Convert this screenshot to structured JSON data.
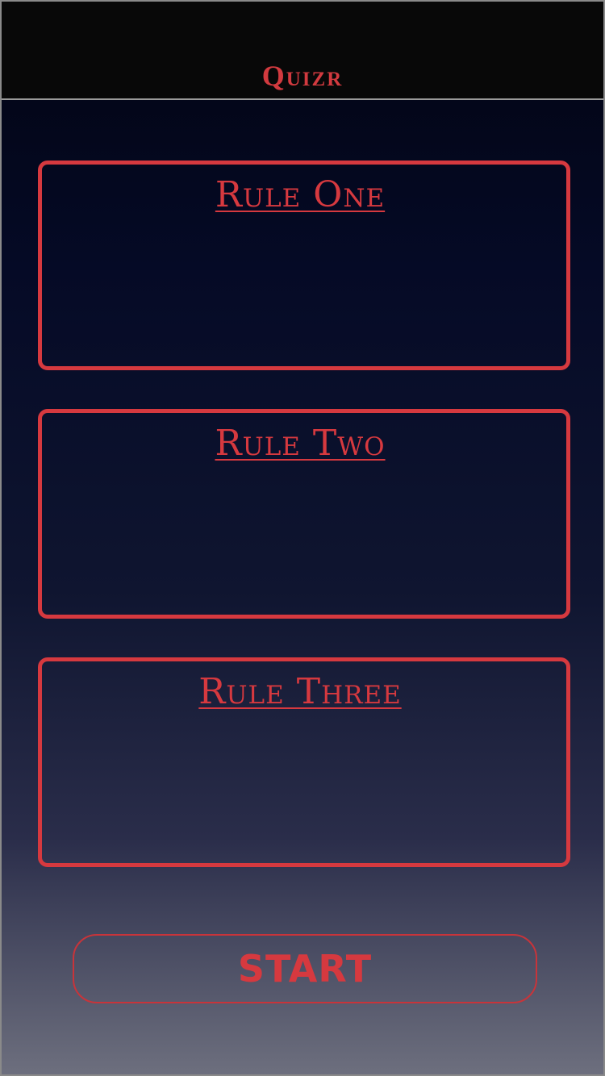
{
  "header": {
    "title": "Quizr"
  },
  "rules": [
    {
      "title": "Rule One",
      "body": ""
    },
    {
      "title": "Rule Two",
      "body": ""
    },
    {
      "title": "Rule Three",
      "body": ""
    }
  ],
  "start_button": {
    "label": "START"
  },
  "colors": {
    "accent": "#d6393f",
    "nav_background": "#080808",
    "gradient_top": "#020412",
    "gradient_bottom": "#6d6f7e"
  }
}
